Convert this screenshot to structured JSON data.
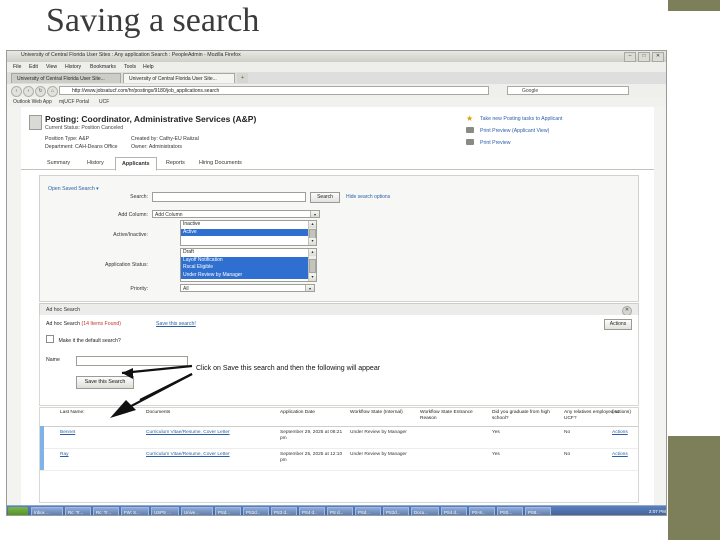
{
  "slide": {
    "title": "Saving a search"
  },
  "annotation": {
    "text": "Click on Save this search and then the following will appear"
  },
  "browser": {
    "window_title": "University of Central Florida User Sites : Any application Search : PeopleAdmin - Mozilla Firefox",
    "menu": [
      "File",
      "Edit",
      "View",
      "History",
      "Bookmarks",
      "Tools",
      "Help"
    ],
    "tabs": [
      {
        "label": "University of Central Florida User Site...",
        "active": false
      },
      {
        "label": "University of Central Florida User Site...",
        "active": true
      },
      {
        "label": "+",
        "active": false
      }
    ],
    "url": "http://www.jobsatucf.com/hr/postings/9180/job_applications.search",
    "search_placeholder": "Google",
    "bookmarks": [
      "Outlook Web App",
      "mjUCF Portal",
      "UCF"
    ],
    "window_buttons": [
      "–",
      "□",
      "✕"
    ]
  },
  "posting": {
    "title": "Posting: Coordinator, Administrative Services (A&P)",
    "status_label": "Current Status: Position Canceled",
    "position_type_label": "Position Type: A&P",
    "department_label": "Department: CAH-Deans Office",
    "created_by_label": "Created by: Cathy-EU Raiizal",
    "owner_label": "Owner: Administrators",
    "right_links": [
      {
        "label": "Take new Posting tasks to Applicant",
        "icon": "star-icon"
      },
      {
        "label": "Print Preview (Applicant View)",
        "icon": "printer-icon"
      },
      {
        "label": "Print Preview",
        "icon": "printer-icon"
      }
    ]
  },
  "page_tabs": [
    {
      "label": "Summary",
      "selected": false
    },
    {
      "label": "History",
      "selected": false
    },
    {
      "label": "Applicants",
      "selected": true
    },
    {
      "label": "Reports",
      "selected": false
    },
    {
      "label": "Hiring Documents",
      "selected": false
    }
  ],
  "search_panel": {
    "open_saved_search": "Open Saved Search",
    "search_label": "Search:",
    "search_value": "",
    "search_button": "Search",
    "hide_options_link": "Hide search options",
    "add_column_label": "Add Column:",
    "add_column_value": "Add Column",
    "active_inactive_label": "Active/Inactive:",
    "active_inactive_options": [
      {
        "label": "Inactive",
        "selected": false
      },
      {
        "label": "Active",
        "selected": true
      }
    ],
    "application_status_label": "Application Status:",
    "application_status_options": [
      {
        "label": "Draft",
        "selected": false
      },
      {
        "label": "Layoff Notification",
        "selected": true
      },
      {
        "label": "Rscal Eligible",
        "selected": true
      },
      {
        "label": "Under Review by Manager",
        "selected": true
      }
    ],
    "priority_label": "Priority:",
    "priority_value": "All"
  },
  "adhoc": {
    "header_title": "Ad hoc Search",
    "close_icon": "close-icon",
    "title": "Ad hoc Search",
    "count": "(14 Items Found)",
    "save_link": "Save this search!",
    "actions_button": "Actions",
    "default_checkbox_label": "Make it the default search?",
    "name_label": "Name",
    "name_value": "",
    "save_button": "Save this Search"
  },
  "results": {
    "columns": [
      "Last Name:",
      "Documents",
      "Application Date",
      "Workflow State (Internal)",
      "Workflow State Entrance Reason",
      "Did you graduate from high school?",
      "Any relatives employed at UCF?",
      "(Actions)"
    ],
    "rows": [
      {
        "last_name": "Bennet",
        "documents": "Curriculum Vitae/Resume, Cover Letter",
        "application_date": "September 29, 2025 at 08:21 pm",
        "workflow_state": "Under Review by Manager",
        "entrance_reason": "",
        "graduated": "Yes",
        "relatives": "No",
        "actions": "Actions"
      },
      {
        "last_name": "Ray",
        "documents": "Curriculum Vitae/Resume, Cover Letter",
        "application_date": "September 25, 2025 at 12:10 pm",
        "workflow_state": "Under Review by Manager",
        "entrance_reason": "",
        "graduated": "Yes",
        "relatives": "No",
        "actions": "Actions"
      }
    ]
  },
  "taskbar": {
    "start_label": "start",
    "items": [
      "Inbox ...",
      "Rc: Tr...",
      "Rc: Tr...",
      "FW: S...",
      "USPS ...",
      "Unive...",
      "PSd...",
      "PS2d...",
      "PS3 d...",
      "PS4 d...",
      "PS d...",
      "PSd...",
      "PS2d...",
      "Docu...",
      "PS4 d...",
      "PS-8...",
      "PS0...",
      "PS8..."
    ],
    "clock": "2:07 PM"
  }
}
